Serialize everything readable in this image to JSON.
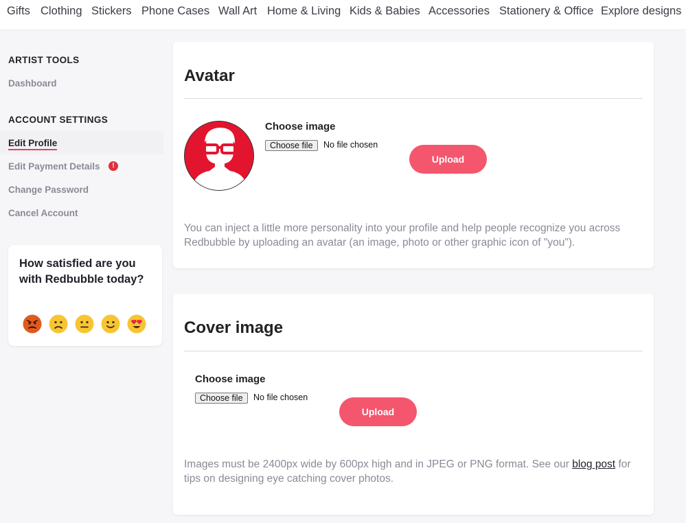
{
  "topnav": {
    "items": [
      "Gifts",
      "Clothing",
      "Stickers",
      "Phone Cases",
      "Wall Art",
      "Home & Living",
      "Kids & Babies",
      "Accessories",
      "Stationery & Office",
      "Explore designs"
    ]
  },
  "sidebar": {
    "artist_tools_heading": "ARTIST TOOLS",
    "dashboard": "Dashboard",
    "account_settings_heading": "ACCOUNT SETTINGS",
    "edit_profile": "Edit Profile",
    "edit_payment": "Edit Payment Details",
    "payment_alert_symbol": "!",
    "change_password": "Change Password",
    "cancel_account": "Cancel Account"
  },
  "survey": {
    "question": "How satisfied are you with Redbubble today?",
    "options": [
      "very-dissatisfied",
      "dissatisfied",
      "neutral",
      "satisfied",
      "very-satisfied"
    ]
  },
  "avatar_card": {
    "title": "Avatar",
    "choose_label": "Choose image",
    "file_button": "Choose file",
    "file_status": "No file chosen",
    "upload_label": "Upload",
    "help_text": "You can inject a little more personality into your profile and help people recognize you across Redbubble by uploading an avatar (an image, photo or other graphic icon of \"you\")."
  },
  "cover_card": {
    "title": "Cover image",
    "choose_label": "Choose image",
    "file_button": "Choose file",
    "file_status": "No file chosen",
    "upload_label": "Upload",
    "help_text_before": "Images must be 2400px wide by 600px high and in JPEG or PNG format. See our",
    "help_link": "blog post",
    "help_text_after": "for tips on designing eye catching cover photos."
  },
  "colors": {
    "accent": "#f4566d",
    "avatar_red": "#e3152e",
    "alert_red": "#e1313d",
    "emoji_yellow": "#f7c531",
    "emoji_angry": "#e05a1e"
  }
}
